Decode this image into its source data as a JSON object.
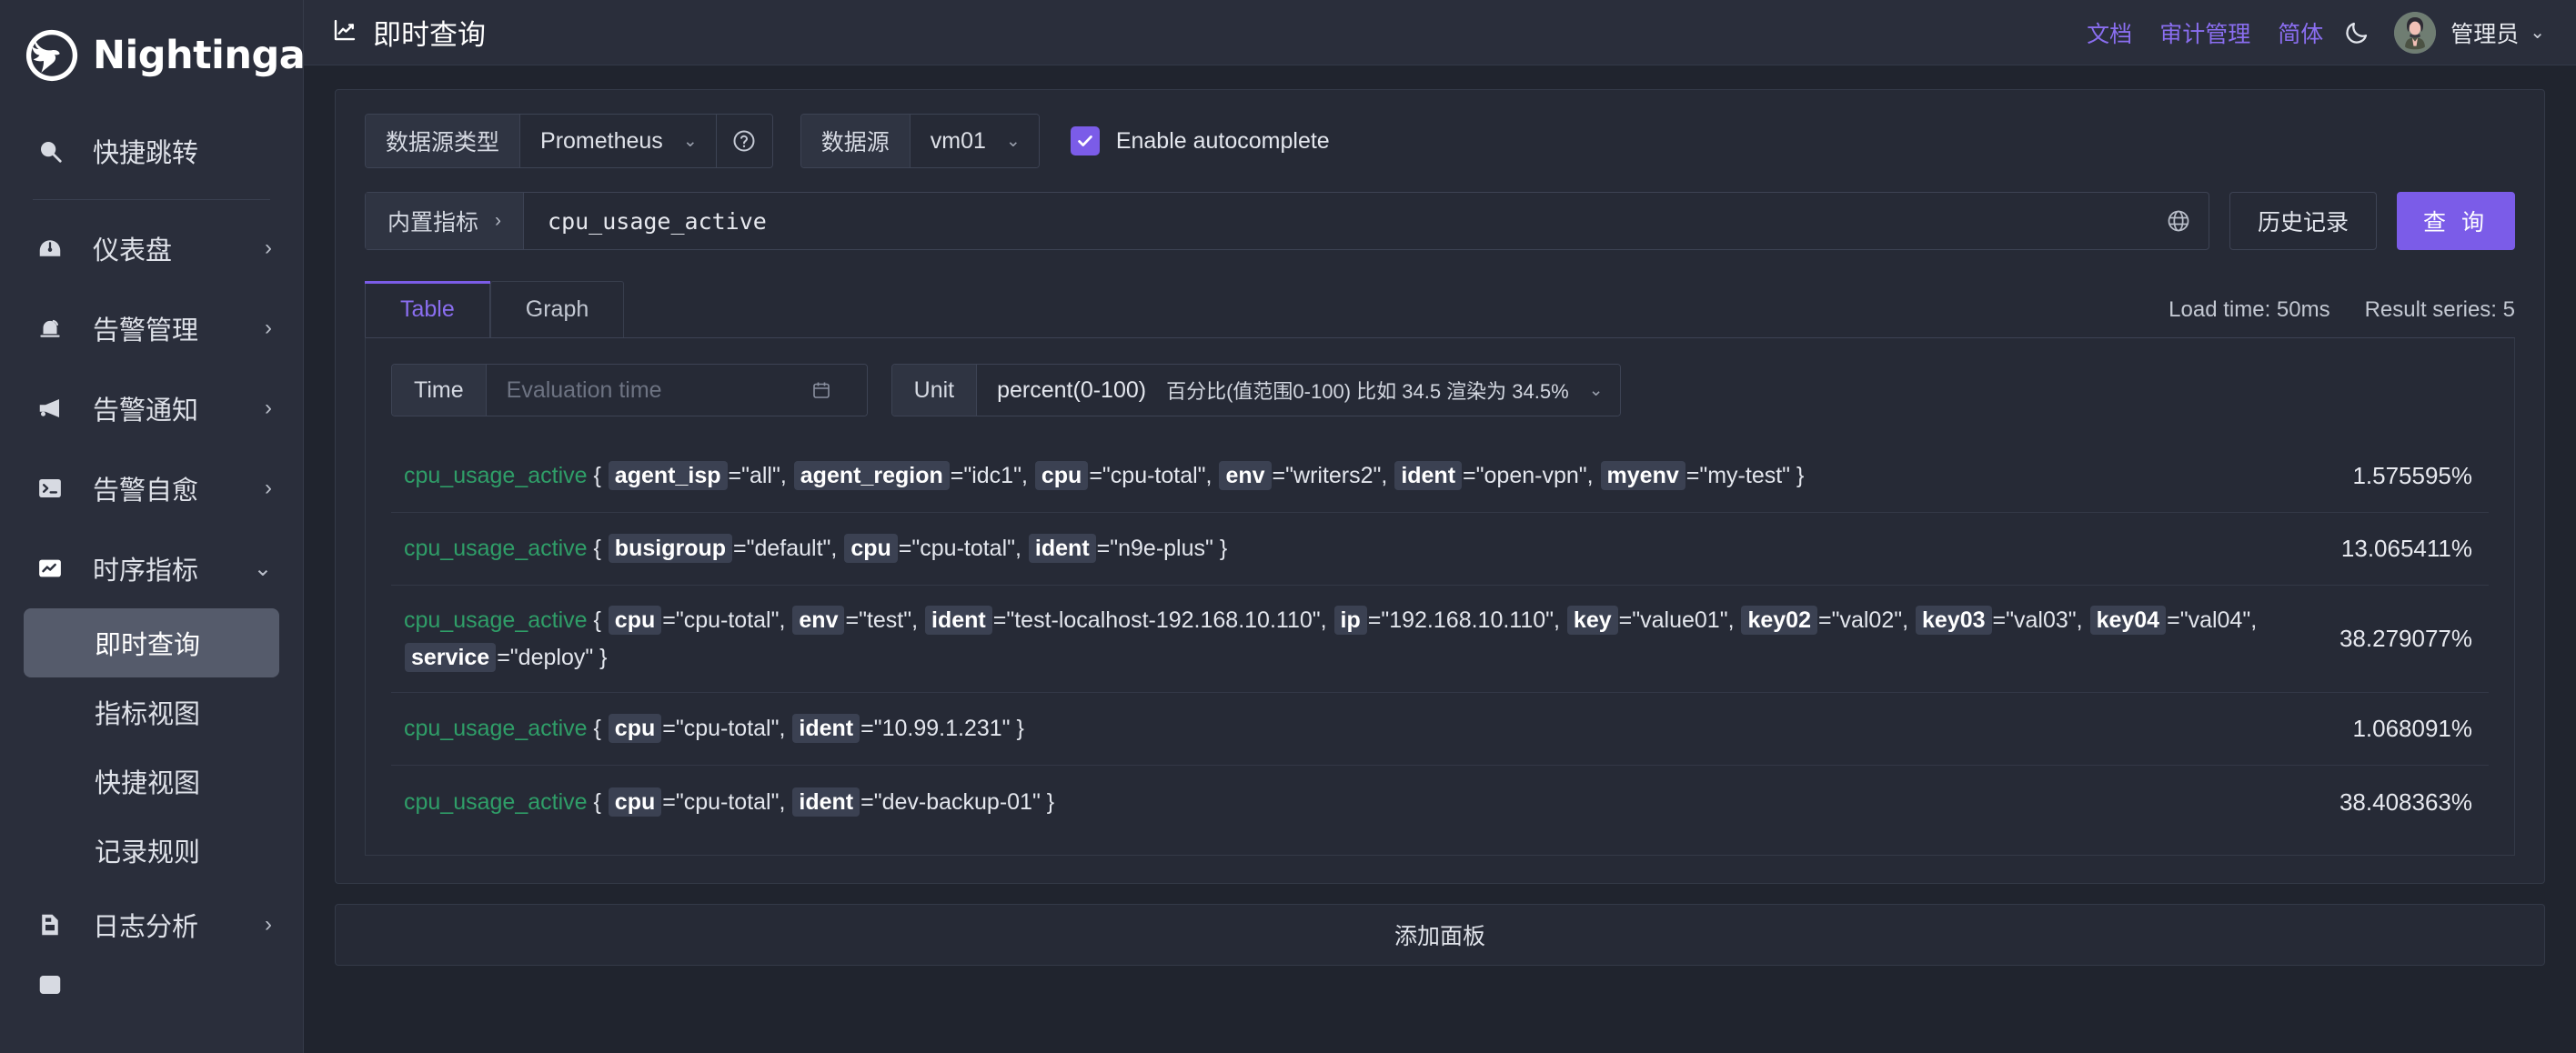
{
  "brand": {
    "name": "Nightingale",
    "logo_icon": "bird-logo-icon"
  },
  "sidebar": {
    "quick_jump": {
      "label": "快捷跳转",
      "icon": "search-icon"
    },
    "items": [
      {
        "label": "仪表盘",
        "icon": "dashboard-icon",
        "arrow": "›"
      },
      {
        "label": "告警管理",
        "icon": "bell-icon",
        "arrow": "›"
      },
      {
        "label": "告警通知",
        "icon": "megaphone-icon",
        "arrow": "›"
      },
      {
        "label": "告警自愈",
        "icon": "terminal-icon",
        "arrow": "›"
      },
      {
        "label": "时序指标",
        "icon": "chart-line-icon",
        "arrow": "⌄"
      }
    ],
    "sub_items": [
      {
        "label": "即时查询",
        "active": true
      },
      {
        "label": "指标视图",
        "active": false
      },
      {
        "label": "快捷视图",
        "active": false
      },
      {
        "label": "记录规则",
        "active": false
      }
    ],
    "items_after": [
      {
        "label": "日志分析",
        "icon": "document-icon",
        "arrow": "›"
      }
    ]
  },
  "topbar": {
    "title": "即时查询",
    "title_icon": "chart-line-icon",
    "links": [
      {
        "label": "文档",
        "name": "docs-link"
      },
      {
        "label": "审计管理",
        "name": "audit-link"
      },
      {
        "label": "简体",
        "name": "language-link"
      }
    ],
    "theme_icon": "moon-icon",
    "avatar_icon": "user-avatar",
    "user": "管理员",
    "user_caret": "⌄"
  },
  "query": {
    "datasource_type_label": "数据源类型",
    "datasource_type_value": "Prometheus",
    "help_icon": "question-circle-icon",
    "datasource_label": "数据源",
    "datasource_value": "vm01",
    "autocomplete_label": "Enable autocomplete",
    "autocomplete_checked": true,
    "metric_picker_label": "内置指标",
    "metric_picker_chevron": "›",
    "expression": "cpu_usage_active",
    "globe_icon": "globe-icon",
    "history_label": "历史记录",
    "run_label": "查 询",
    "caret": "⌄"
  },
  "tabs": [
    {
      "label": "Table",
      "active": true
    },
    {
      "label": "Graph",
      "active": false
    }
  ],
  "meta": {
    "load_time": "Load time: 50ms",
    "result_series": "Result series: 5"
  },
  "controls": {
    "time_label": "Time",
    "time_placeholder": "Evaluation time",
    "calendar_icon": "calendar-icon",
    "unit_label": "Unit",
    "unit_value": "percent(0-100)",
    "unit_desc": "百分比(值范围0-100) 比如 34.5 渲染为 34.5%"
  },
  "results": [
    {
      "metric": "cpu_usage_active",
      "labels": [
        {
          "key": "agent_isp",
          "value": "all"
        },
        {
          "key": "agent_region",
          "value": "idc1"
        },
        {
          "key": "cpu",
          "value": "cpu-total"
        },
        {
          "key": "env",
          "value": "writers2"
        },
        {
          "key": "ident",
          "value": "open-vpn"
        },
        {
          "key": "myenv",
          "value": "my-test"
        }
      ],
      "value": "1.575595%"
    },
    {
      "metric": "cpu_usage_active",
      "labels": [
        {
          "key": "busigroup",
          "value": "default"
        },
        {
          "key": "cpu",
          "value": "cpu-total"
        },
        {
          "key": "ident",
          "value": "n9e-plus"
        }
      ],
      "value": "13.065411%"
    },
    {
      "metric": "cpu_usage_active",
      "labels": [
        {
          "key": "cpu",
          "value": "cpu-total"
        },
        {
          "key": "env",
          "value": "test"
        },
        {
          "key": "ident",
          "value": "test-localhost-192.168.10.110"
        },
        {
          "key": "ip",
          "value": "192.168.10.110"
        },
        {
          "key": "key",
          "value": "value01"
        },
        {
          "key": "key02",
          "value": "val02"
        },
        {
          "key": "key03",
          "value": "val03"
        },
        {
          "key": "key04",
          "value": "val04"
        },
        {
          "key": "service",
          "value": "deploy"
        }
      ],
      "value": "38.279077%"
    },
    {
      "metric": "cpu_usage_active",
      "labels": [
        {
          "key": "cpu",
          "value": "cpu-total"
        },
        {
          "key": "ident",
          "value": "10.99.1.231"
        }
      ],
      "value": "1.068091%"
    },
    {
      "metric": "cpu_usage_active",
      "labels": [
        {
          "key": "cpu",
          "value": "cpu-total"
        },
        {
          "key": "ident",
          "value": "dev-backup-01"
        }
      ],
      "value": "38.408363%"
    }
  ],
  "add_panel_label": "添加面板",
  "colors": {
    "accent": "#7b5ce8",
    "link": "#8a6ef0",
    "metric": "#2f9e68",
    "sidebar_bg": "#2a2e3b",
    "panel_bg": "#262a36",
    "page_bg": "#20242e"
  }
}
